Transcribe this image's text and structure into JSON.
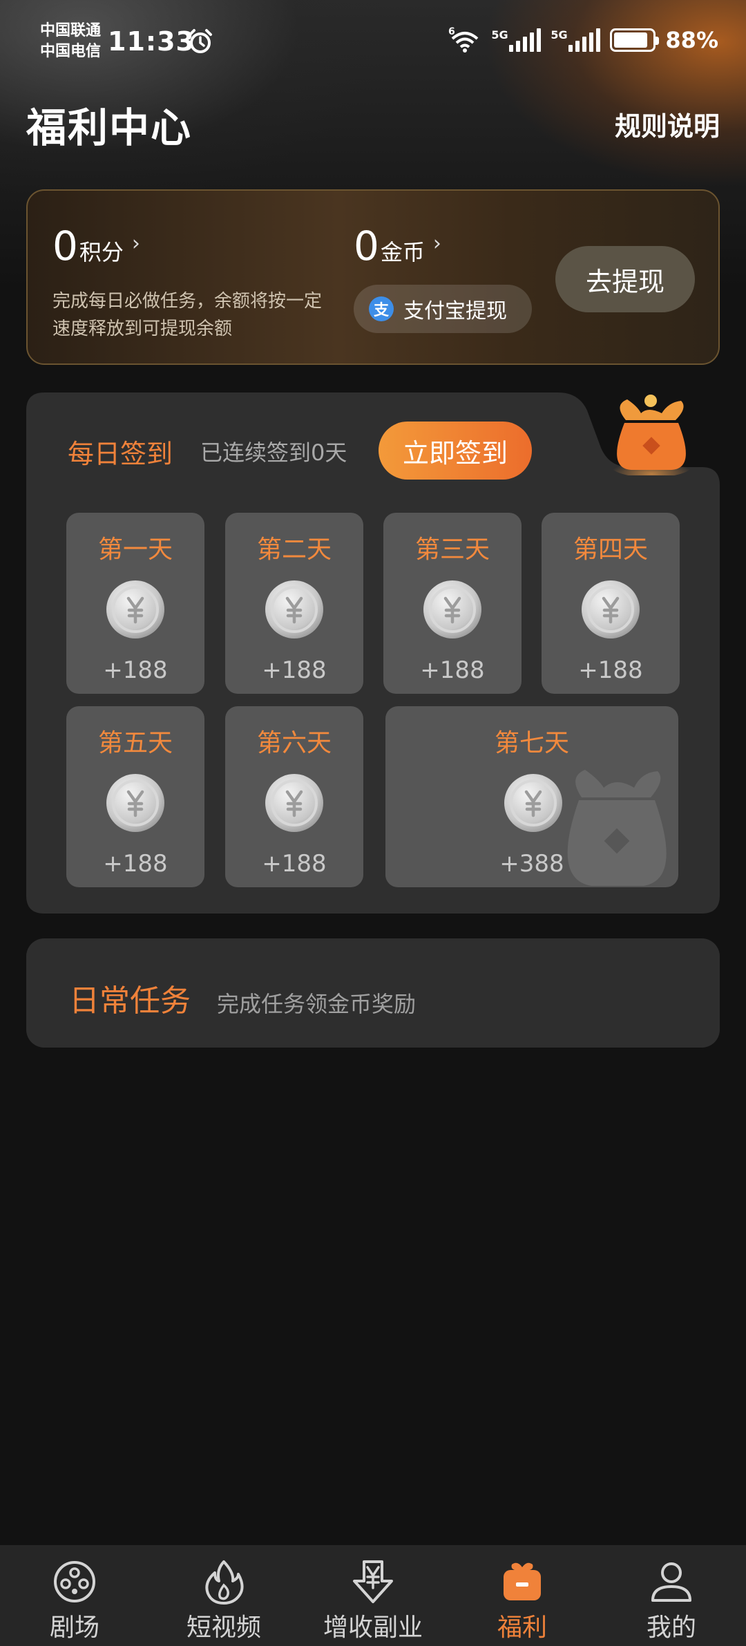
{
  "status_bar": {
    "carrier1": "中国联通",
    "carrier2": "中国电信",
    "time": "11:33",
    "wifi_badge": "6",
    "sim1_badge": "5G",
    "sim2_badge": "5G",
    "battery_percent": "88%",
    "battery_level": 0.88
  },
  "header": {
    "title": "福利中心",
    "rules_label": "规则说明"
  },
  "balance": {
    "points_value": "0",
    "points_unit": "积分",
    "coins_value": "0",
    "coins_unit": "金币",
    "description": "完成每日必做任务，余额将按一定速度释放到可提现余额",
    "alipay_label": "支付宝提现",
    "withdraw_label": "去提现"
  },
  "signin": {
    "title": "每日签到",
    "streak_text": "已连续签到0天",
    "button_label": "立即签到",
    "days": [
      {
        "label": "第一天",
        "reward": "+188"
      },
      {
        "label": "第二天",
        "reward": "+188"
      },
      {
        "label": "第三天",
        "reward": "+188"
      },
      {
        "label": "第四天",
        "reward": "+188"
      },
      {
        "label": "第五天",
        "reward": "+188"
      },
      {
        "label": "第六天",
        "reward": "+188"
      },
      {
        "label": "第七天",
        "reward": "+388"
      }
    ]
  },
  "tasks": {
    "title": "日常任务",
    "subtitle": "完成任务领金币奖励"
  },
  "nav": {
    "items": [
      {
        "label": "剧场",
        "icon": "film-reel-icon"
      },
      {
        "label": "短视频",
        "icon": "flame-icon"
      },
      {
        "label": "增收副业",
        "icon": "yuan-download-icon"
      },
      {
        "label": "福利",
        "icon": "gift-box-icon"
      },
      {
        "label": "我的",
        "icon": "user-icon"
      }
    ],
    "active_index": 3
  },
  "colors": {
    "accent_orange": "#f0823a",
    "background": "#121212"
  }
}
